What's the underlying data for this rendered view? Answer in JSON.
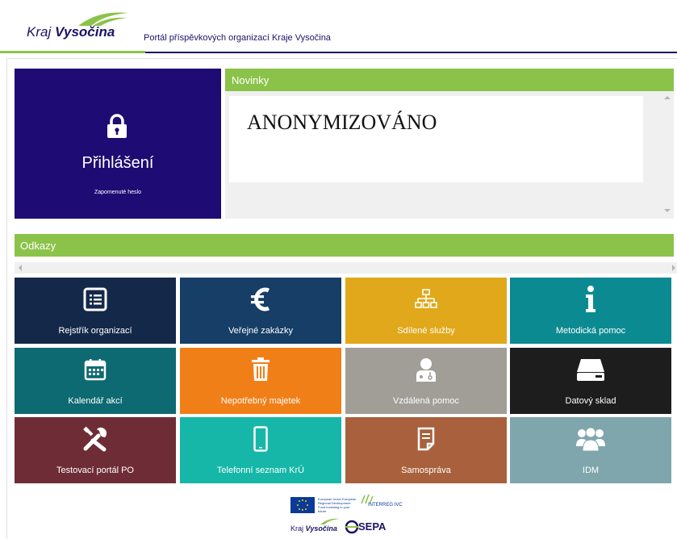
{
  "header": {
    "logo_kraj": "Kraj",
    "logo_vysocina": "Vysočina",
    "portal_title": "Portál příspěvkových organizací Kraje Vysočina"
  },
  "login": {
    "label": "Přihlášení",
    "forgot_password": "Zapomenuté heslo"
  },
  "news": {
    "title": "Novinky",
    "content": "ANONYMIZOVÁNO"
  },
  "links": {
    "title": "Odkazy",
    "tiles": [
      {
        "label": "Rejstřík organizací",
        "icon": "list-icon",
        "color": "#14294a"
      },
      {
        "label": "Veřejné zakázky",
        "icon": "euro-icon",
        "color": "#163e66"
      },
      {
        "label": "Sdílené služby",
        "icon": "sitemap-icon",
        "color": "#e0a81a"
      },
      {
        "label": "Metodická pomoc",
        "icon": "info-icon",
        "color": "#0c8a92"
      },
      {
        "label": "Kalendář akcí",
        "icon": "calendar-icon",
        "color": "#0d6a72"
      },
      {
        "label": "Nepotřebný majetek",
        "icon": "trash-icon",
        "color": "#f17f17"
      },
      {
        "label": "Vzdálená pomoc",
        "icon": "doctor-icon",
        "color": "#a09e96"
      },
      {
        "label": "Datový sklad",
        "icon": "hard-drive-icon",
        "color": "#1d1d1d"
      },
      {
        "label": "Testovací portál PO",
        "icon": "tools-icon",
        "color": "#6e2d36"
      },
      {
        "label": "Telefonní seznam KrÚ",
        "icon": "phone-icon",
        "color": "#16b7a8"
      },
      {
        "label": "Samospráva",
        "icon": "document-icon",
        "color": "#a8613c"
      },
      {
        "label": "IDM",
        "icon": "users-icon",
        "color": "#7fa6ac"
      }
    ]
  },
  "footer": {
    "eu_text": "European Union European Regional Development Fund Investing in your future",
    "interreg": "INTERREG IVC",
    "kraj": "Kraj",
    "vysocina": "Vysočina",
    "sepa": "SEPA"
  }
}
